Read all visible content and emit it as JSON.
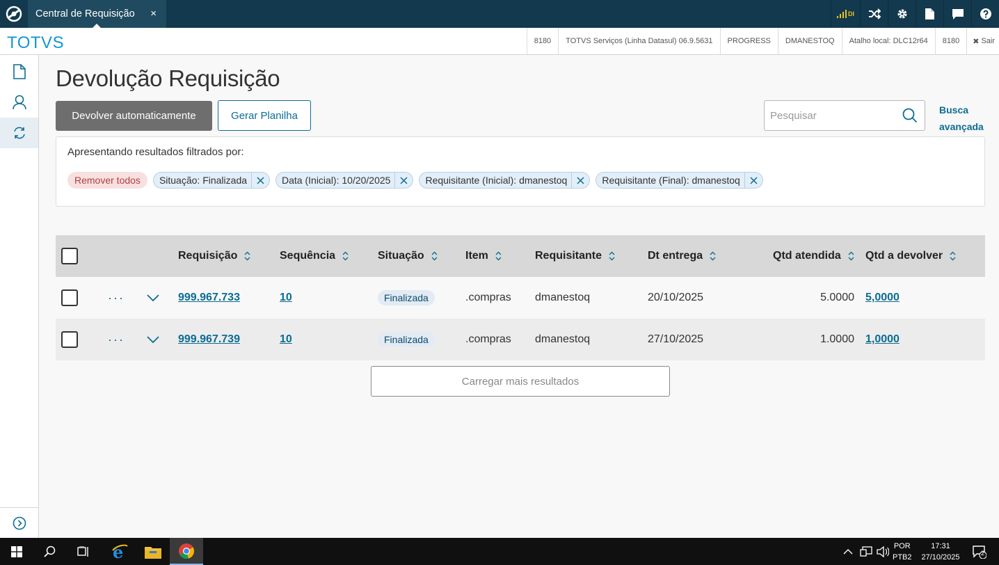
{
  "app_tab": {
    "title": "Central de Requisição",
    "close": "×"
  },
  "top_icons": {
    "signal_label": "DI"
  },
  "header": {
    "brand": "TOTVS",
    "info": [
      "8180",
      "TOTVS Serviços (Linha Datasul) 06.9.5631",
      "PROGRESS",
      "DMANESTOQ",
      "Atalho local: DLC12r64",
      "8180"
    ],
    "logout": "Sair"
  },
  "page": {
    "title": "Devolução Requisição",
    "primary_button": "Devolver automaticamente",
    "secondary_button": "Gerar Planilha",
    "search_placeholder": "Pesquisar",
    "advanced_search": "Busca avançada"
  },
  "filters": {
    "label": "Apresentando resultados filtrados por:",
    "remove_all": "Remover todos",
    "chips": [
      "Situação: Finalizada",
      "Data (Inicial): 10/20/2025",
      "Requisitante (Inicial): dmanestoq",
      "Requisitante (Final): dmanestoq"
    ]
  },
  "table": {
    "columns": [
      "Requisição",
      "Sequência",
      "Situação",
      "Item",
      "Requisitante",
      "Dt entrega",
      "Qtd atendida",
      "Qtd a devolver"
    ],
    "rows": [
      {
        "requisicao": "999.967.733",
        "sequencia": "10",
        "situacao": "Finalizada",
        "item": ".compras",
        "requisitante": "dmanestoq",
        "dt_entrega": "20/10/2025",
        "qtd_atendida": "5.0000",
        "qtd_devolver": "5,0000"
      },
      {
        "requisicao": "999.967.739",
        "sequencia": "10",
        "situacao": "Finalizada",
        "item": ".compras",
        "requisitante": "dmanestoq",
        "dt_entrega": "27/10/2025",
        "qtd_atendida": "1.0000",
        "qtd_devolver": "1,0000"
      }
    ],
    "row_actions": "···"
  },
  "load_more": "Carregar mais resultados",
  "taskbar": {
    "lang_1": "POR",
    "lang_2": "PTB2",
    "time": "17:31",
    "date": "27/10/2025",
    "notifications": "2"
  },
  "colors": {
    "topbar": "#12394d",
    "brand": "#1397d0",
    "link": "#0c6c94"
  }
}
